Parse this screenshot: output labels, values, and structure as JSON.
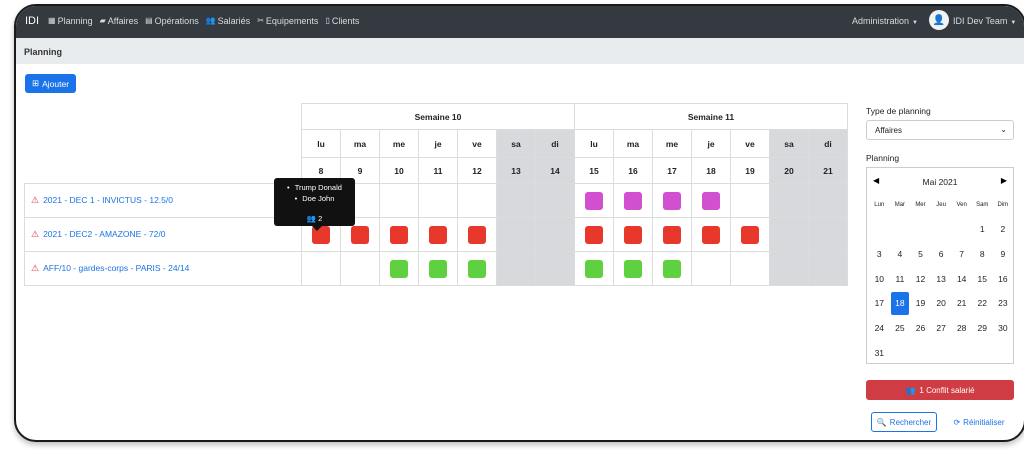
{
  "app": {
    "brand": "IDI"
  },
  "nav": [
    {
      "label": "Planning",
      "icon": "calendar-icon",
      "glyph": "▦"
    },
    {
      "label": "Affaires",
      "icon": "briefcase-icon",
      "glyph": "▰"
    },
    {
      "label": "Opérations",
      "icon": "clipboard-icon",
      "glyph": "▤"
    },
    {
      "label": "Salariés",
      "icon": "users-icon",
      "glyph": "👥"
    },
    {
      "label": "Equipements",
      "icon": "tools-icon",
      "glyph": "✂"
    },
    {
      "label": "Clients",
      "icon": "id-card-icon",
      "glyph": "▯"
    }
  ],
  "admin": {
    "label": "Administration"
  },
  "user": {
    "name": "IDI Dev Team"
  },
  "page": {
    "title": "Planning"
  },
  "toolbar": {
    "add_label": "Ajouter"
  },
  "planning": {
    "weeks": [
      "Semaine 10",
      "Semaine 11"
    ],
    "day_names": [
      "lu",
      "ma",
      "me",
      "je",
      "ve",
      "sa",
      "di",
      "lu",
      "ma",
      "me",
      "je",
      "ve",
      "sa",
      "di"
    ],
    "day_numbers": [
      "8",
      "9",
      "10",
      "11",
      "12",
      "13",
      "14",
      "15",
      "16",
      "17",
      "18",
      "19",
      "20",
      "21"
    ],
    "rows": [
      {
        "name": "2021 - DEC 1 - INVICTUS - 12.5/0",
        "color": "#d24fcf",
        "days": [
          0,
          0,
          0,
          0,
          0,
          0,
          0,
          1,
          1,
          1,
          1,
          0,
          0,
          0
        ]
      },
      {
        "name": "2021 - DEC2 - AMAZONE - 72/0",
        "color": "#e8382c",
        "days": [
          1,
          1,
          1,
          1,
          1,
          0,
          0,
          1,
          1,
          1,
          1,
          1,
          0,
          0
        ]
      },
      {
        "name": "AFF/10 - gardes-corps - PARIS - 24/14",
        "color": "#5fd03f",
        "days": [
          0,
          0,
          1,
          1,
          1,
          0,
          0,
          1,
          1,
          1,
          0,
          0,
          0,
          0
        ]
      }
    ],
    "tooltip": {
      "names": [
        "Trump Donald",
        "Doe John"
      ],
      "count": "2"
    }
  },
  "sidebar": {
    "type_label": "Type de planning",
    "type_value": "Affaires",
    "planning_label": "Planning",
    "calendar": {
      "month": "Mai 2021",
      "dow": [
        "Lun",
        "Mar",
        "Mer",
        "Jeu",
        "Ven",
        "Sam",
        "Dim"
      ],
      "days": [
        "",
        "",
        "",
        "",
        "",
        "1",
        "2",
        "3",
        "4",
        "5",
        "6",
        "7",
        "8",
        "9",
        "10",
        "11",
        "12",
        "13",
        "14",
        "15",
        "16",
        "17",
        "18",
        "19",
        "20",
        "21",
        "22",
        "23",
        "24",
        "25",
        "26",
        "27",
        "28",
        "29",
        "30",
        "31"
      ],
      "selected": "18"
    },
    "conflict_label": "1 Conflit salarié",
    "search_label": "Rechercher",
    "reset_label": "Réinitialiser"
  },
  "colors": {
    "primary": "#1a73e8",
    "danger": "#d03c43",
    "navbar": "#343a40",
    "weekend": "#d8d9dc"
  }
}
